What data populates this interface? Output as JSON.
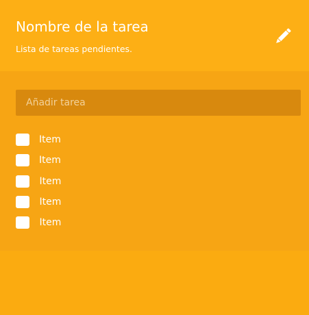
{
  "colors": {
    "header": "#fdaf15",
    "body": "#f7a514",
    "footer": "#fbab10",
    "input_background": "#d8890e",
    "text": "#ffffff"
  },
  "header": {
    "title": "Nombre de la tarea",
    "subtitle": "Lista de tareas pendientes.",
    "edit_icon": "pencil-icon"
  },
  "task_input": {
    "placeholder": "Añadir tarea",
    "value": ""
  },
  "tasks": [
    {
      "label": "Item",
      "checked": false
    },
    {
      "label": "Item",
      "checked": false
    },
    {
      "label": "Item",
      "checked": false
    },
    {
      "label": "Item",
      "checked": false
    },
    {
      "label": "Item",
      "checked": false
    }
  ]
}
